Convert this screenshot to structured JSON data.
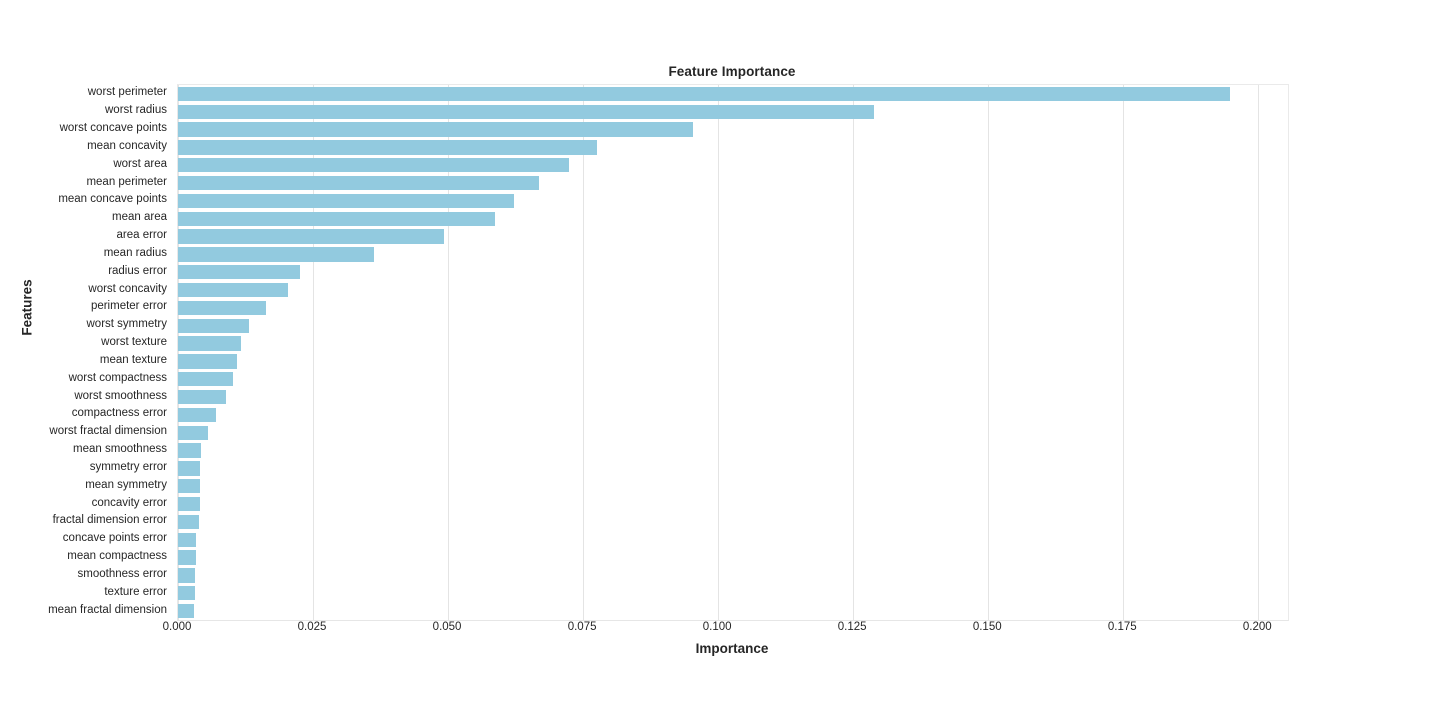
{
  "chart_data": {
    "type": "bar",
    "orientation": "horizontal",
    "title": "Feature Importance",
    "xlabel": "Importance",
    "ylabel": "Features",
    "xlim": [
      0.0,
      0.2055
    ],
    "xticks": [
      0.0,
      0.025,
      0.05,
      0.075,
      0.1,
      0.125,
      0.15,
      0.175,
      0.2
    ],
    "xtick_labels": [
      "0.000",
      "0.025",
      "0.050",
      "0.075",
      "0.100",
      "0.125",
      "0.150",
      "0.175",
      "0.200"
    ],
    "grid": "vertical",
    "legend": "none",
    "bar_color": "#92cadf",
    "categories": [
      "worst perimeter",
      "worst radius",
      "worst concave points",
      "mean concavity",
      "worst area",
      "mean perimeter",
      "mean concave points",
      "mean area",
      "area error",
      "mean radius",
      "radius error",
      "worst concavity",
      "perimeter error",
      "worst symmetry",
      "worst texture",
      "mean texture",
      "worst compactness",
      "worst smoothness",
      "compactness error",
      "worst fractal dimension",
      "mean smoothness",
      "symmetry error",
      "mean symmetry",
      "concavity error",
      "fractal dimension error",
      "concave points error",
      "mean compactness",
      "smoothness error",
      "texture error",
      "mean fractal dimension"
    ],
    "values": [
      0.1947,
      0.1288,
      0.0953,
      0.0775,
      0.0723,
      0.0668,
      0.0622,
      0.0587,
      0.0493,
      0.0363,
      0.0226,
      0.0204,
      0.0162,
      0.0131,
      0.0116,
      0.0109,
      0.0101,
      0.0088,
      0.007,
      0.0055,
      0.0042,
      0.0041,
      0.0041,
      0.004,
      0.0039,
      0.0034,
      0.0034,
      0.0031,
      0.0031,
      0.003
    ]
  }
}
